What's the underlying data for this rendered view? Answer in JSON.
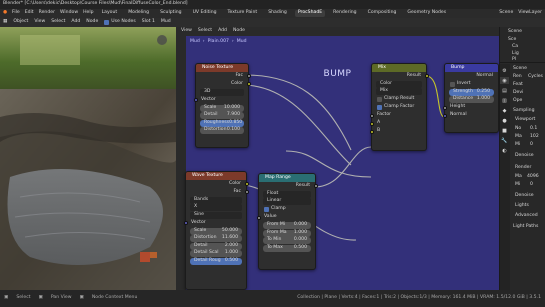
{
  "window": {
    "title": "Blender* [C:\\Users\\dekic\\Desktop\\Course Files\\Mud\\FinalDiffuseColor_End.blend]"
  },
  "menu": {
    "items": [
      "File",
      "Edit",
      "Render",
      "Window",
      "Help",
      "Layout",
      "Modeling",
      "Sculpting",
      "UV Editing",
      "Texture Paint",
      "Shading",
      "Animation",
      "Rendering",
      "Compositing",
      "Geometry Nodes",
      "Scripting"
    ],
    "scene_label": "Scene",
    "viewlayer_label": "ViewLayer"
  },
  "toolbar2": {
    "object_mode": "Object",
    "view": "View",
    "select": "Select",
    "add": "Add",
    "node": "Node",
    "use_nodes": "Use Nodes",
    "slot": "Slot 1",
    "material": "Mud",
    "pos": "Pos",
    "active_tab": "ProcShadE",
    "tabs": [
      "Layout",
      "Modeling",
      "Sculpting",
      "UV Editing",
      "Texture Paint",
      "Shading",
      "Animation",
      "Rendering",
      "Compositing",
      "Geometry Nodes",
      "Scripting"
    ]
  },
  "node_editor": {
    "breadcrumb": [
      "Mud",
      "Plain.007",
      "Mud"
    ],
    "frame_label": "BUMP",
    "noise_texture": {
      "title": "Noise Texture",
      "out_fac": "Fac",
      "out_color": "Color",
      "dim": "3D",
      "vector": "Vector",
      "scale_label": "Scale",
      "scale": "10.000",
      "detail_label": "Detail",
      "detail": "7.900",
      "rough_label": "Roughness",
      "rough": "0.850",
      "dist_label": "Distortion",
      "dist": "0.100"
    },
    "wave_texture": {
      "title": "Wave Texture",
      "out_color": "Color",
      "out_fac": "Fac",
      "type": "Bands",
      "dir": "X",
      "profile": "Sine",
      "vector": "Vector",
      "scale_label": "Scale",
      "scale": "50.000",
      "dist_label": "Distortion",
      "dist": "11.600",
      "detail_label": "Detail",
      "detail": "2.000",
      "dscale_label": "Detail Scal",
      "dscale": "1.000",
      "drough_label": "Detail Roug",
      "drough": "0.500"
    },
    "map_range": {
      "title": "Map Range",
      "out": "Result",
      "type": "Float",
      "interp": "Linear",
      "clamp": "Clamp",
      "value": "Value",
      "from_min_label": "From Mi",
      "from_min": "0.000",
      "from_max_label": "From Ma",
      "from_max": "1.000",
      "to_min_label": "To Min",
      "to_min": "0.000",
      "to_max_label": "To Max",
      "to_max": "0.500"
    },
    "mix": {
      "title": "Mix",
      "out": "Result",
      "data_type": "Color",
      "blend": "Mix",
      "clamp_result": "Clamp Result",
      "clamp_factor": "Clamp Factor",
      "factor": "Factor",
      "a": "A",
      "b": "B"
    },
    "bump": {
      "title": "Bump",
      "out": "Normal",
      "invert": "Invert",
      "strength_label": "Strength",
      "strength": "0.250",
      "distance_label": "Distance",
      "distance": "1.000",
      "height": "Height",
      "normal": "Normal"
    }
  },
  "right": {
    "outliner_title": "Scene",
    "outliner_items": [
      "Sce",
      "Ca",
      "Lig",
      "Pl"
    ],
    "scene_label": "Scene",
    "props": [
      "Ren",
      "Feat",
      "Devi",
      "Ope"
    ],
    "render_engine": "Cycles",
    "sampling": "Sampling",
    "viewport": "Viewport",
    "noise_thr": "No",
    "max": "Ma",
    "min": "Mi",
    "denoise": "Denoise",
    "render": "Render",
    "max2": "Ma",
    "min2": "Mi",
    "denoise2": "Denoise",
    "lights": "Lights",
    "advanced": "Advanced",
    "light_paths": "Light Paths",
    "values": [
      "0.1",
      "102",
      "0",
      "4096",
      "0"
    ]
  },
  "status": {
    "left1": "Select",
    "left2": "Pan View",
    "left3": "Node Context Menu",
    "right": "Collection | Plane | Verts:4 | Faces:1 | Tris:2 | Objects:1/3 | Memory: 161.4 MiB | VRAM: 1.5/12.0 GiB | 3.5.1"
  },
  "colors": {
    "frame": "#33307a",
    "noise_head": "#7c3a2a",
    "wave_head": "#7c3a2a",
    "map_head": "#2a6e73",
    "mix_head": "#5d6a26",
    "bump_head": "#3a3aa0"
  }
}
